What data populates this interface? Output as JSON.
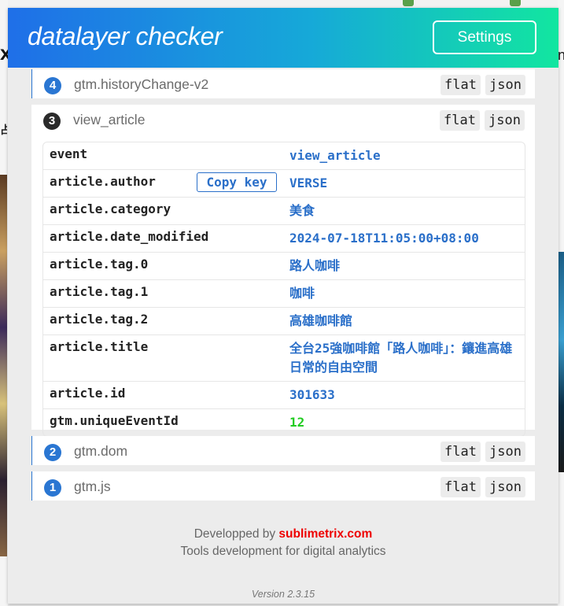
{
  "app": {
    "title": "datalayer checker",
    "settings_label": "Settings"
  },
  "events": [
    {
      "number": "4",
      "name": "gtm.historyChange-v2",
      "flat": "flat",
      "json": "json",
      "expanded": false
    },
    {
      "number": "3",
      "name": "view_article",
      "flat": "flat",
      "json": "json",
      "expanded": true
    },
    {
      "number": "2",
      "name": "gtm.dom",
      "flat": "flat",
      "json": "json",
      "expanded": false
    },
    {
      "number": "1",
      "name": "gtm.js",
      "flat": "flat",
      "json": "json",
      "expanded": false
    }
  ],
  "detail": {
    "copy_key_label": "Copy key",
    "rows": [
      {
        "key": "event",
        "value": "view_article"
      },
      {
        "key": "article.author",
        "value": "VERSE"
      },
      {
        "key": "article.category",
        "value": "美食"
      },
      {
        "key": "article.date_modified",
        "value": "2024-07-18T11:05:00+08:00"
      },
      {
        "key": "article.tag.0",
        "value": "路人咖啡"
      },
      {
        "key": "article.tag.1",
        "value": "咖啡"
      },
      {
        "key": "article.tag.2",
        "value": "高雄咖啡館"
      },
      {
        "key": "article.title",
        "value": "全台25強咖啡館「路人咖啡」：鑲進高雄日常的自由空間"
      },
      {
        "key": "article.id",
        "value": "301633"
      },
      {
        "key": "gtm.uniqueEventId",
        "value": "12"
      }
    ]
  },
  "footer": {
    "prefix": "Developped by ",
    "brand": "sublimetrix.com",
    "tagline": "Tools development for digital analytics",
    "version": "Version 2.3.15"
  },
  "colors": {
    "accent": "#2a76d2",
    "brand": "#ee0000",
    "number_value": "#22cc22"
  },
  "background": {
    "left_glyph": "x",
    "left_glyph2": "占",
    "right_glyph": "n"
  }
}
